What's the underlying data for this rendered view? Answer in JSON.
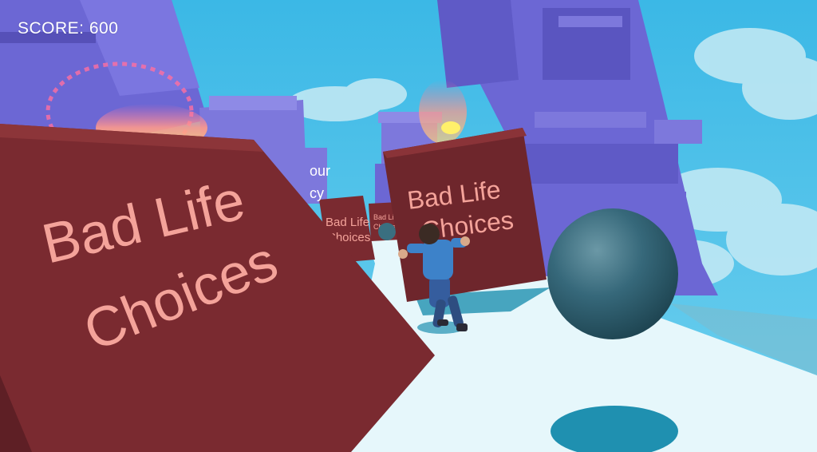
{
  "hud": {
    "score_label": "SCORE:",
    "score_value": "600"
  },
  "crates": [
    {
      "line1": "Bad Life",
      "line2": "Choices"
    },
    {
      "line1": "Bad Life",
      "line2": "Choices"
    },
    {
      "line1": "Bad Life",
      "line2": "Choices"
    },
    {
      "line1": "Bad Life",
      "line2": "Choices"
    }
  ],
  "partial_crate": {
    "line1": "our",
    "line2": "cy"
  },
  "colors": {
    "sky": "#4fc3e8",
    "cloud": "#bfe8f4",
    "building": "#6c67d4",
    "building_dark": "#5650b8",
    "crate": "#7a2a30",
    "crate_text": "#f4a39a",
    "floor": "#e6f7fb",
    "boulder": "#2f6170"
  }
}
